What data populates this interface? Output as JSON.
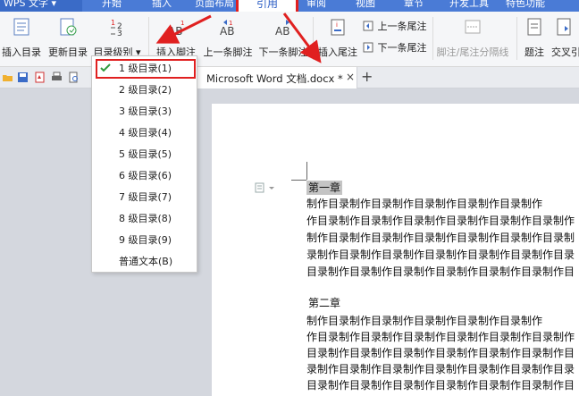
{
  "app": {
    "name": "WPS 文字",
    "dropdown_caret": "▾"
  },
  "menu_tabs": [
    "开始",
    "插入",
    "页面布局",
    "引用",
    "审阅",
    "视图",
    "章节",
    "开发工具",
    "特色功能"
  ],
  "ribbon": {
    "insert_toc": "插入目录",
    "update_toc": "更新目录",
    "toc_level": "目录级别",
    "insert_footnote": "插入脚注",
    "prev_footnote": "上一条脚注",
    "next_footnote": "下一条脚注",
    "insert_endnote": "插入尾注",
    "prev_endnote": "上一条尾注",
    "next_endnote": "下一条尾注",
    "separator_line": "脚注/尾注分隔线",
    "caption": "题注",
    "cross_ref": "交叉引",
    "ab_glyph": "AB"
  },
  "doc_tab": {
    "title": "Microsoft Word 文档.docx *",
    "close": "×",
    "add": "+"
  },
  "dropdown": {
    "items": [
      "1 级目录(1)",
      "2 级目录(2)",
      "3 级目录(3)",
      "4 级目录(4)",
      "5 级目录(5)",
      "6 级目录(6)",
      "7 级目录(7)",
      "8 级目录(8)",
      "9 级目录(9)",
      "普通文本(B)"
    ],
    "selected_index": 0
  },
  "document": {
    "chapter1": "第一章",
    "chapter1_lines": [
      "        制作目录制作目录制作目录制作目录制作目录制作",
      "作目录制作目录制作目录制作目录制作目录制作目录制作",
      "制作目录制作目录制作目录制作目录制作目录制作目录制",
      "录制作目录制作目录制作目录制作目录制作目录制作目录",
      "目录制作目录制作目录制作目录制作目录制作目录制作目"
    ],
    "chapter2": "第二章",
    "chapter2_lines": [
      "        制作目录制作目录制作目录制作目录制作目录制作",
      "作目录制作目录制作目录制作目录制作目录制作目录制作",
      "目录制作目录制作目录制作目录制作目录制作目录制作目",
      "录制作目录制作目录制作目录制作目录制作目录制作目录",
      "目录制作目录制作目录制作目录制作目录制作目录制作目"
    ]
  },
  "colors": {
    "accent_blue": "#4a7bd6",
    "highlight_red": "#e02020",
    "check_green": "#2e9a3c"
  }
}
